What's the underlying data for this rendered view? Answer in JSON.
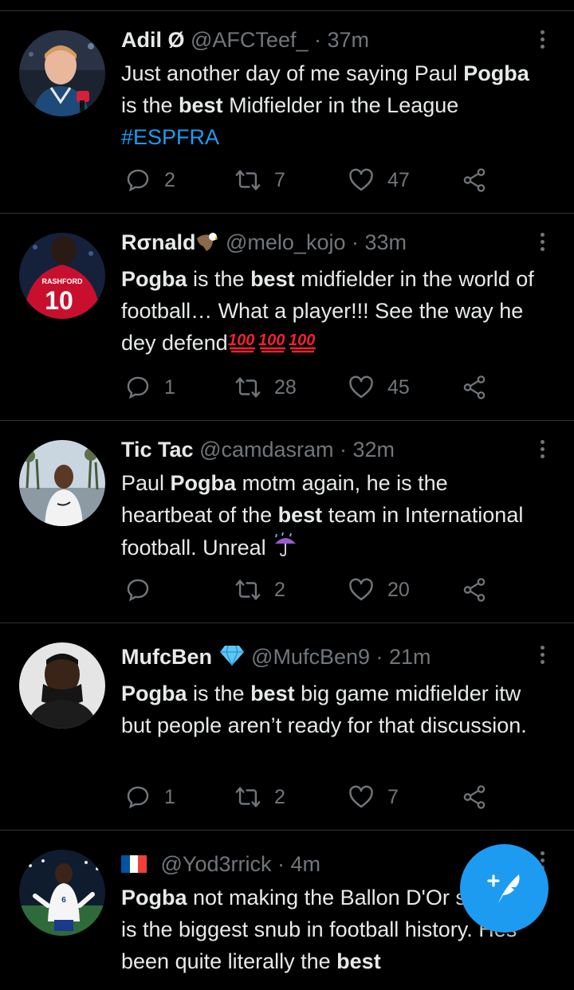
{
  "tweets": [
    {
      "name": "Adil Ø",
      "handle": "@AFCTeef_",
      "time": "· 37m",
      "text": [
        {
          "t": "Just another day of me saying Paul "
        },
        {
          "t": "Pogba",
          "b": true
        },
        {
          "t": " is the "
        },
        {
          "t": "best",
          "b": true
        },
        {
          "t": " Midfielder in the League "
        },
        {
          "t": "#ESPFRA",
          "h": true
        }
      ],
      "replies": "2",
      "retweets": "7",
      "likes": "47"
    },
    {
      "name": "Rσnald",
      "handle": "@melo_kojo",
      "time": "· 33m",
      "name_emoji": "eagle-icon",
      "text": [
        {
          "t": "Pogba",
          "b": true
        },
        {
          "t": " is the "
        },
        {
          "t": "best",
          "b": true
        },
        {
          "t": " midfielder in the world of football… What a player!!! See the way he dey defend"
        }
      ],
      "trailing_emoji": "hundred-points-icon ×3",
      "replies": "1",
      "retweets": "28",
      "likes": "45"
    },
    {
      "name": "Tic Tac",
      "handle": "@camdasram",
      "time": "· 32m",
      "text": [
        {
          "t": "Paul "
        },
        {
          "t": "Pogba",
          "b": true
        },
        {
          "t": " motm again, he is the heartbeat of the "
        },
        {
          "t": "best",
          "b": true
        },
        {
          "t": " team in International football. Unreal "
        }
      ],
      "trailing_emoji": "umbrella-rain-icon",
      "replies": "",
      "retweets": "2",
      "likes": "20"
    },
    {
      "name": "MufcBen",
      "handle": "@MufcBen9",
      "time": "· 21m",
      "name_emoji": "diamond-icon",
      "text": [
        {
          "t": "Pogba",
          "b": true
        },
        {
          "t": " is the "
        },
        {
          "t": "best",
          "b": true
        },
        {
          "t": " big game midfielder itw but people aren’t ready for that discussion."
        }
      ],
      "replies": "1",
      "retweets": "2",
      "likes": "7"
    },
    {
      "name": "",
      "handle": "@Yod3rrick",
      "time": "· 4m",
      "name_emoji": "france-flag-icon",
      "text": [
        {
          "t": "Pogba",
          "b": true
        },
        {
          "t": " not making the Ballon D'Or shortlist is the biggest snub in football history. Hes been quite literally the "
        },
        {
          "t": "best",
          "b": true
        }
      ]
    }
  ],
  "colors": {
    "accent": "#1d9bf0",
    "muted": "#71767b",
    "divider": "#2f3336",
    "heart_fab": "#1d9bf0",
    "hundred": "#f4212e"
  },
  "fab": {
    "icon": "compose-tweet-icon"
  }
}
